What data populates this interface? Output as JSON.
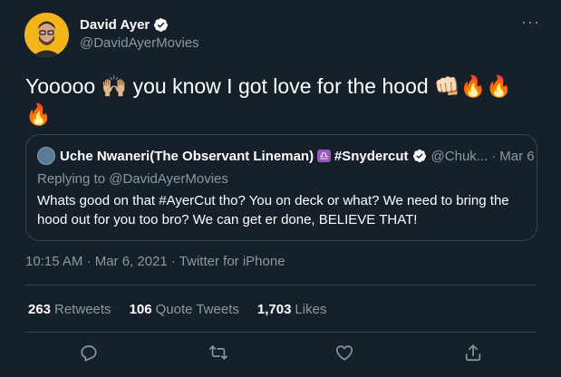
{
  "author": {
    "display_name": "David Ayer",
    "handle": "@DavidAyerMovies"
  },
  "tweet": {
    "text_before": "Yooooo ",
    "emoji_hands": "🙌🏼",
    "text_middle": " you know I got love for the hood ",
    "emoji_fist": "👊🏻",
    "emoji_fire": "🔥🔥🔥"
  },
  "quote": {
    "display_name": "Uche Nwaneri(The Observant Lineman)",
    "badge": "♎",
    "tag": "#Snydercut",
    "handle": "@Chuk...",
    "date": "Mar 6",
    "replying_to": "Replying to @DavidAyerMovies",
    "text": "Whats good on that #AyerCut tho? You on deck or what? We need to bring the hood out for you too bro? We can get er done, BELIEVE THAT!"
  },
  "meta": "10:15 AM · Mar 6, 2021 · Twitter for iPhone",
  "stats": {
    "retweets_count": "263",
    "retweets_label": "Retweets",
    "quote_count": "106",
    "quote_label": "Quote Tweets",
    "likes_count": "1,703",
    "likes_label": "Likes"
  },
  "more_label": "···",
  "colors": {
    "background": "#15202b",
    "secondary_text": "#8899a6",
    "border": "#38444d",
    "avatar_bg": "#f2b31b"
  },
  "icons": [
    "verified-icon",
    "more-icon",
    "reply-icon",
    "retweet-icon",
    "like-icon",
    "share-icon"
  ]
}
